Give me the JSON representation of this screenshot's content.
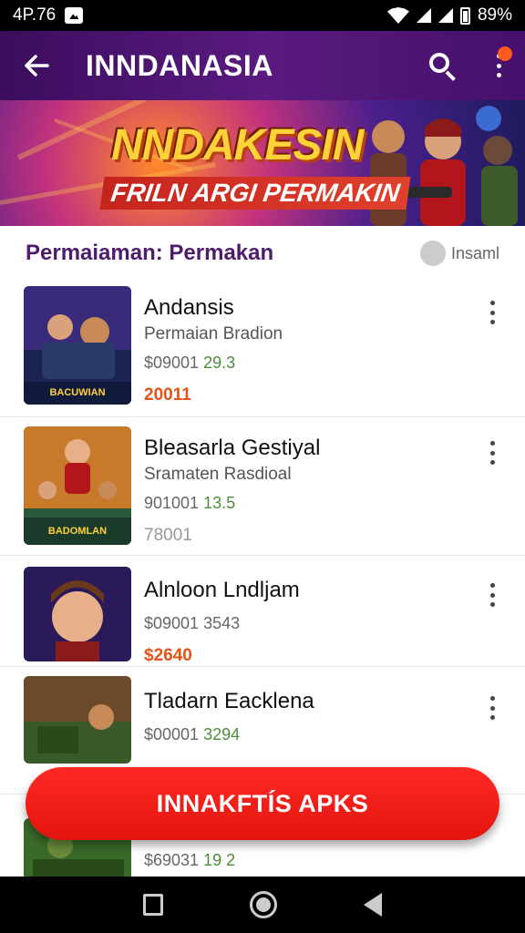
{
  "status_bar": {
    "time": "4P.76",
    "battery": "89%"
  },
  "app_bar": {
    "title": "INNDANASIA",
    "back_icon": "arrow-left-icon",
    "search_icon": "search-icon",
    "more_icon": "more-vert-icon"
  },
  "banner": {
    "title": "NNDAKESIN",
    "subtitle": "FRILN ARGI PERMAKIN"
  },
  "section": {
    "title": "Permaiaman: Permakan",
    "action_label": "Insaml"
  },
  "items": [
    {
      "name": "Andansis",
      "subtitle": "Permaian Bradion",
      "meta_prefix": "$09001",
      "meta_rating": "29.3",
      "price": "20011",
      "price_muted": false
    },
    {
      "name": "Bleasarla Gestiyal",
      "subtitle": "Sramaten Rasdioal",
      "meta_prefix": "901001",
      "meta_rating": "13.5",
      "price": "78001",
      "price_muted": true
    },
    {
      "name": "Alnloon Lndljam",
      "subtitle": "",
      "meta_prefix": "$09001",
      "meta_rating": "3543",
      "price": "$2640",
      "price_muted": false
    },
    {
      "name": "Tladarn Eacklena",
      "subtitle": "",
      "meta_prefix": "$00001",
      "meta_rating": "3294",
      "price": "",
      "price_muted": false
    },
    {
      "name": "",
      "subtitle": "",
      "meta_prefix": "$69031",
      "meta_rating": "19 2",
      "price": "",
      "price_muted": false
    }
  ],
  "thumb_labels": [
    "BACUWIAN",
    "BADOMLAN",
    "",
    "",
    ""
  ],
  "install_button": {
    "label": "INNAKFTÍS APKS"
  },
  "colors": {
    "app_bar": "#4a1470",
    "accent": "#e8140f",
    "section_title": "#4e1b6e",
    "price": "#e05416"
  }
}
